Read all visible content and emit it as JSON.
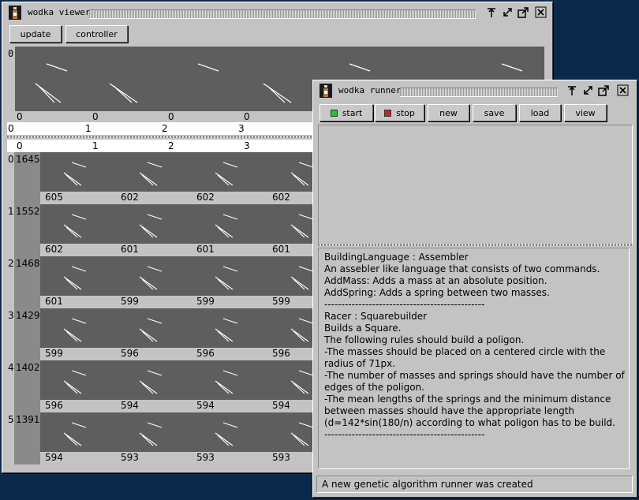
{
  "viewer": {
    "title": "wodka viewer",
    "buttons": {
      "update": "update",
      "controller": "controller"
    },
    "top": {
      "row_label": "0",
      "values": [
        "0",
        "0",
        "0",
        "0"
      ],
      "headers": [
        "0",
        "1",
        "2",
        "3"
      ]
    },
    "grid": {
      "col_headers": [
        "0",
        "1",
        "2",
        "3"
      ],
      "rows": [
        {
          "index": "0",
          "score": "1645",
          "values": [
            "605",
            "602",
            "602",
            "602"
          ]
        },
        {
          "index": "1",
          "score": "1552",
          "values": [
            "602",
            "601",
            "601",
            "601"
          ]
        },
        {
          "index": "2",
          "score": "1468",
          "values": [
            "601",
            "599",
            "599",
            "599"
          ]
        },
        {
          "index": "3",
          "score": "1429",
          "values": [
            "599",
            "596",
            "596",
            "596"
          ]
        },
        {
          "index": "4",
          "score": "1402",
          "values": [
            "596",
            "594",
            "594",
            "594"
          ]
        },
        {
          "index": "5",
          "score": "1391",
          "values": [
            "594",
            "593",
            "593",
            "593"
          ]
        }
      ]
    }
  },
  "runner": {
    "title": "wodka runner",
    "buttons": {
      "start": "start",
      "stop": "stop",
      "new": "new",
      "save": "save",
      "load": "load",
      "view": "view"
    },
    "start_color": "#22cc22",
    "stop_color": "#cc2222",
    "text_lines": [
      "BuildingLanguage : Assembler",
      "An assebler like language that consists of two commands.",
      "AddMass: Adds a mass at an absolute position.",
      "AddSpring: Adds a spring between two masses.",
      "-----------------------------------------------",
      "Racer : Squarebuilder",
      "Builds a Square.",
      "The following rules should build a poligon.",
      "-The masses should be placed on a centered circle with the",
      "radius of 71px.",
      "-The number of masses and springs should have the number of",
      "edges of the poligon.",
      "-The mean lengths of the springs and the minimum distance",
      "between masses should have the appropriate length",
      "(d=142*sin(180/n) according to what poligon has to be build.",
      "-----------------------------------------------"
    ],
    "status": "A new genetic algorithm runner was created"
  },
  "icons": {
    "app": "wodka-bottle-icon",
    "titlebar_buttons": [
      "shade-icon",
      "minimize-icon",
      "maximize-icon",
      "close-icon"
    ]
  }
}
